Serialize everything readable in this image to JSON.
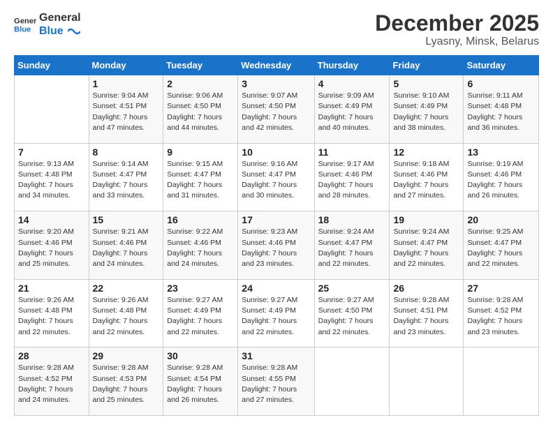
{
  "logo": {
    "line1": "General",
    "line2": "Blue"
  },
  "header": {
    "month": "December 2025",
    "location": "Lyasny, Minsk, Belarus"
  },
  "days_of_week": [
    "Sunday",
    "Monday",
    "Tuesday",
    "Wednesday",
    "Thursday",
    "Friday",
    "Saturday"
  ],
  "weeks": [
    [
      {
        "day": "",
        "info": ""
      },
      {
        "day": "1",
        "info": "Sunrise: 9:04 AM\nSunset: 4:51 PM\nDaylight: 7 hours\nand 47 minutes."
      },
      {
        "day": "2",
        "info": "Sunrise: 9:06 AM\nSunset: 4:50 PM\nDaylight: 7 hours\nand 44 minutes."
      },
      {
        "day": "3",
        "info": "Sunrise: 9:07 AM\nSunset: 4:50 PM\nDaylight: 7 hours\nand 42 minutes."
      },
      {
        "day": "4",
        "info": "Sunrise: 9:09 AM\nSunset: 4:49 PM\nDaylight: 7 hours\nand 40 minutes."
      },
      {
        "day": "5",
        "info": "Sunrise: 9:10 AM\nSunset: 4:49 PM\nDaylight: 7 hours\nand 38 minutes."
      },
      {
        "day": "6",
        "info": "Sunrise: 9:11 AM\nSunset: 4:48 PM\nDaylight: 7 hours\nand 36 minutes."
      }
    ],
    [
      {
        "day": "7",
        "info": "Sunrise: 9:13 AM\nSunset: 4:48 PM\nDaylight: 7 hours\nand 34 minutes."
      },
      {
        "day": "8",
        "info": "Sunrise: 9:14 AM\nSunset: 4:47 PM\nDaylight: 7 hours\nand 33 minutes."
      },
      {
        "day": "9",
        "info": "Sunrise: 9:15 AM\nSunset: 4:47 PM\nDaylight: 7 hours\nand 31 minutes."
      },
      {
        "day": "10",
        "info": "Sunrise: 9:16 AM\nSunset: 4:47 PM\nDaylight: 7 hours\nand 30 minutes."
      },
      {
        "day": "11",
        "info": "Sunrise: 9:17 AM\nSunset: 4:46 PM\nDaylight: 7 hours\nand 28 minutes."
      },
      {
        "day": "12",
        "info": "Sunrise: 9:18 AM\nSunset: 4:46 PM\nDaylight: 7 hours\nand 27 minutes."
      },
      {
        "day": "13",
        "info": "Sunrise: 9:19 AM\nSunset: 4:46 PM\nDaylight: 7 hours\nand 26 minutes."
      }
    ],
    [
      {
        "day": "14",
        "info": "Sunrise: 9:20 AM\nSunset: 4:46 PM\nDaylight: 7 hours\nand 25 minutes."
      },
      {
        "day": "15",
        "info": "Sunrise: 9:21 AM\nSunset: 4:46 PM\nDaylight: 7 hours\nand 24 minutes."
      },
      {
        "day": "16",
        "info": "Sunrise: 9:22 AM\nSunset: 4:46 PM\nDaylight: 7 hours\nand 24 minutes."
      },
      {
        "day": "17",
        "info": "Sunrise: 9:23 AM\nSunset: 4:46 PM\nDaylight: 7 hours\nand 23 minutes."
      },
      {
        "day": "18",
        "info": "Sunrise: 9:24 AM\nSunset: 4:47 PM\nDaylight: 7 hours\nand 22 minutes."
      },
      {
        "day": "19",
        "info": "Sunrise: 9:24 AM\nSunset: 4:47 PM\nDaylight: 7 hours\nand 22 minutes."
      },
      {
        "day": "20",
        "info": "Sunrise: 9:25 AM\nSunset: 4:47 PM\nDaylight: 7 hours\nand 22 minutes."
      }
    ],
    [
      {
        "day": "21",
        "info": "Sunrise: 9:26 AM\nSunset: 4:48 PM\nDaylight: 7 hours\nand 22 minutes."
      },
      {
        "day": "22",
        "info": "Sunrise: 9:26 AM\nSunset: 4:48 PM\nDaylight: 7 hours\nand 22 minutes."
      },
      {
        "day": "23",
        "info": "Sunrise: 9:27 AM\nSunset: 4:49 PM\nDaylight: 7 hours\nand 22 minutes."
      },
      {
        "day": "24",
        "info": "Sunrise: 9:27 AM\nSunset: 4:49 PM\nDaylight: 7 hours\nand 22 minutes."
      },
      {
        "day": "25",
        "info": "Sunrise: 9:27 AM\nSunset: 4:50 PM\nDaylight: 7 hours\nand 22 minutes."
      },
      {
        "day": "26",
        "info": "Sunrise: 9:28 AM\nSunset: 4:51 PM\nDaylight: 7 hours\nand 23 minutes."
      },
      {
        "day": "27",
        "info": "Sunrise: 9:28 AM\nSunset: 4:52 PM\nDaylight: 7 hours\nand 23 minutes."
      }
    ],
    [
      {
        "day": "28",
        "info": "Sunrise: 9:28 AM\nSunset: 4:52 PM\nDaylight: 7 hours\nand 24 minutes."
      },
      {
        "day": "29",
        "info": "Sunrise: 9:28 AM\nSunset: 4:53 PM\nDaylight: 7 hours\nand 25 minutes."
      },
      {
        "day": "30",
        "info": "Sunrise: 9:28 AM\nSunset: 4:54 PM\nDaylight: 7 hours\nand 26 minutes."
      },
      {
        "day": "31",
        "info": "Sunrise: 9:28 AM\nSunset: 4:55 PM\nDaylight: 7 hours\nand 27 minutes."
      },
      {
        "day": "",
        "info": ""
      },
      {
        "day": "",
        "info": ""
      },
      {
        "day": "",
        "info": ""
      }
    ]
  ]
}
